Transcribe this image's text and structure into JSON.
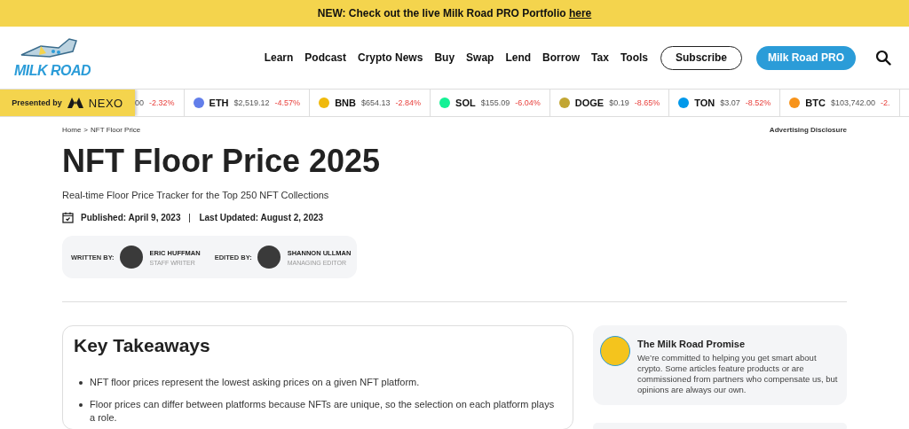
{
  "announcement": {
    "text": "NEW: Check out the live Milk Road PRO Portfolio ",
    "link": "here"
  },
  "header": {
    "logo": "MILK ROAD",
    "nav": [
      "Learn",
      "Podcast",
      "Crypto News",
      "Buy",
      "Swap",
      "Lend",
      "Borrow",
      "Tax",
      "Tools"
    ],
    "buttons": [
      {
        "label": "Subscribe",
        "kind": "outline"
      },
      {
        "label": "Milk Road PRO",
        "kind": "filled"
      }
    ]
  },
  "ticker": {
    "sponsor_label": "Presented by",
    "sponsor": "NEXO",
    "items": [
      {
        "price": "00",
        "change": "-2.32%"
      },
      {
        "symbol": "ETH",
        "price": "$2,519.12",
        "change": "-4.57%",
        "color": "#627eea"
      },
      {
        "symbol": "BNB",
        "price": "$654.13",
        "change": "-2.84%",
        "color": "#f0b90b"
      },
      {
        "symbol": "SOL",
        "price": "$155.09",
        "change": "-6.04%",
        "color": "#14f195"
      },
      {
        "symbol": "DOGE",
        "price": "$0.19",
        "change": "-8.65%",
        "color": "#c2a633"
      },
      {
        "symbol": "TON",
        "price": "$3.07",
        "change": "-8.52%",
        "color": "#0098ea"
      },
      {
        "symbol": "BTC",
        "price": "$103,742.00",
        "change": "-2.",
        "color": "#f7931a"
      }
    ]
  },
  "breadcrumb": {
    "items": [
      "Home",
      "NFT Floor Price"
    ],
    "separator": ">"
  },
  "advertising_disclosure": "Advertising Disclosure",
  "title": "NFT Floor Price 2025",
  "subtitle": "Real-time Floor Price Tracker for the Top 250 NFT Collections",
  "published": "Published: April 9, 2023",
  "updated": "Last Updated: August 2, 2023",
  "authors": [
    {
      "role": "WRITTEN BY:",
      "name": "ERIC HUFFMAN",
      "position": "STAFF WRITER"
    },
    {
      "role": "EDITED BY:",
      "name": "SHANNON ULLMAN",
      "position": "MANAGING EDITOR"
    }
  ],
  "key_takeaways": {
    "title": "Key Takeaways",
    "items": [
      "NFT floor prices represent the lowest asking prices on a given NFT platform.",
      "Floor prices can differ between platforms because NFTs are unique, so the selection on each platform plays a role."
    ]
  },
  "promise": {
    "title": "The Milk Road Promise",
    "text": "We’re committed to helping you get smart about crypto. Some articles feature products or are commissioned from partners who compensate us, but opinions are always our own."
  }
}
